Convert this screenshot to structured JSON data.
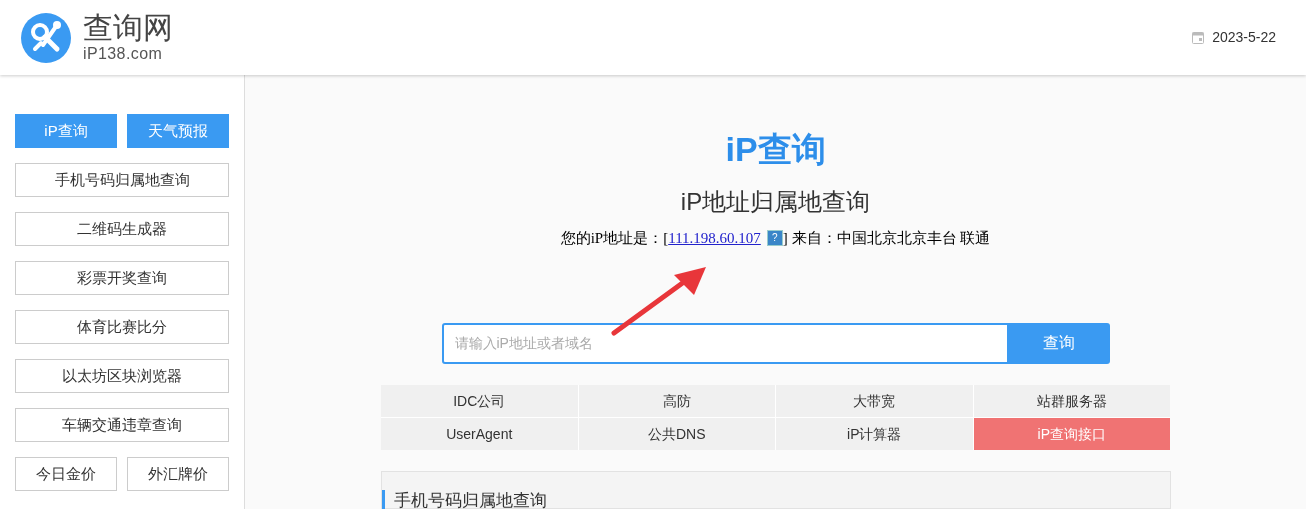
{
  "logo": {
    "name": "查询网",
    "domain": "iP138.com"
  },
  "header": {
    "date": "2023-5-22"
  },
  "sidebar": {
    "rows": [
      [
        {
          "label": "iP查询",
          "highlighted": true
        },
        {
          "label": "天气预报",
          "highlighted": true
        }
      ],
      [
        {
          "label": "手机号码归属地查询",
          "highlighted": false
        }
      ],
      [
        {
          "label": "二维码生成器",
          "highlighted": false
        }
      ],
      [
        {
          "label": "彩票开奖查询",
          "highlighted": false
        }
      ],
      [
        {
          "label": "体育比赛比分",
          "highlighted": false
        }
      ],
      [
        {
          "label": "以太坊区块浏览器",
          "highlighted": false
        }
      ],
      [
        {
          "label": "车辆交通违章查询",
          "highlighted": false
        }
      ],
      [
        {
          "label": "今日金价",
          "highlighted": false
        },
        {
          "label": "外汇牌价",
          "highlighted": false
        }
      ]
    ]
  },
  "main": {
    "heading": "iP查询",
    "subtitle": "iP地址归属地查询",
    "ip_line": {
      "prefix": "您的iP地址是：[",
      "ip": "111.198.60.107",
      "help": "?",
      "suffix": "] 来自：中国北京北京丰台 联通"
    },
    "search": {
      "placeholder": "请输入iP地址或者域名",
      "button": "查询"
    },
    "links": [
      {
        "label": "IDC公司",
        "highlighted": false
      },
      {
        "label": "高防",
        "highlighted": false
      },
      {
        "label": "大带宽",
        "highlighted": false
      },
      {
        "label": "站群服务器",
        "highlighted": false
      },
      {
        "label": "UserAgent",
        "highlighted": false
      },
      {
        "label": "公共DNS",
        "highlighted": false
      },
      {
        "label": "iP计算器",
        "highlighted": false
      },
      {
        "label": "iP查询接口",
        "highlighted": true
      }
    ],
    "section_title": "手机号码归属地查询"
  }
}
